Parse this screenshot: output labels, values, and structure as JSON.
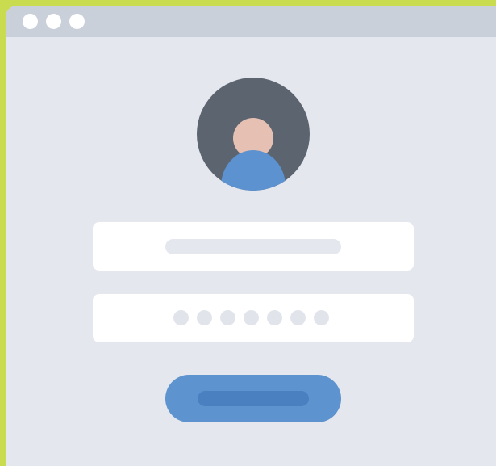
{
  "window": {
    "controls": [
      "close",
      "minimize",
      "maximize"
    ]
  },
  "avatar": {
    "icon": "user-avatar-icon"
  },
  "username_field": {
    "value": "",
    "placeholder": ""
  },
  "password_field": {
    "masked_length": 7
  },
  "login_button": {
    "label": ""
  },
  "colors": {
    "outer_background": "#c9dc50",
    "window_background": "#e4e7ed",
    "titlebar": "#cad0da",
    "avatar_circle": "#5c6470",
    "avatar_head": "#e6c0b3",
    "avatar_body": "#5b92cf",
    "button": "#5d93ce",
    "button_inner": "#4a7fc0",
    "field_background": "#ffffff"
  }
}
